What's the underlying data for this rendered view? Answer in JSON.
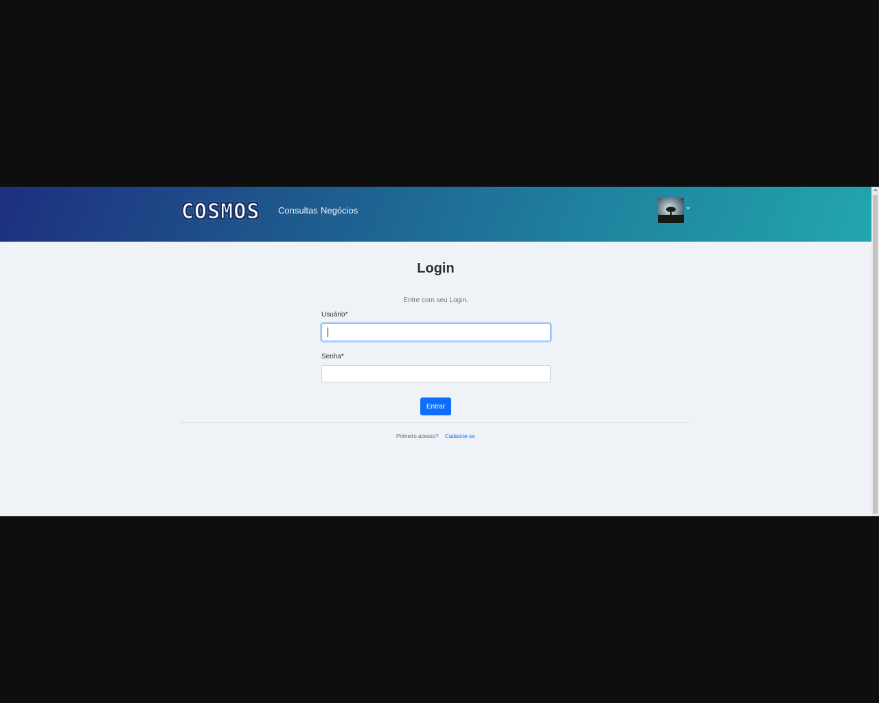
{
  "navbar": {
    "brand": "COSMOS",
    "links": [
      {
        "label": "Consultas"
      },
      {
        "label": "Negócios"
      }
    ],
    "gradient_colors": [
      "#1d2f7e",
      "#22a6ad"
    ]
  },
  "login": {
    "title": "Login",
    "subtitle": "Entre com seu Login.",
    "username_label": "Usuário*",
    "username_value": "",
    "password_label": "Senha*",
    "password_value": "",
    "submit_label": "Entrar",
    "first_access_text": "Primeiro acesso?",
    "signup_label": "Cadastre-se",
    "accent_color": "#0d6efd"
  }
}
